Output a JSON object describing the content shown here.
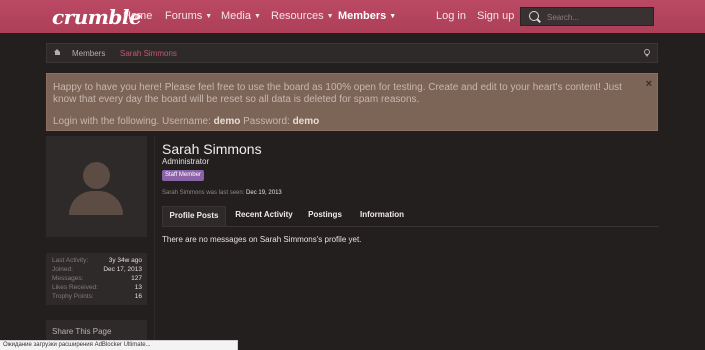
{
  "header": {
    "logo": "crumble",
    "nav": [
      {
        "label": "Home"
      },
      {
        "label": "Forums"
      },
      {
        "label": "Media"
      },
      {
        "label": "Resources"
      },
      {
        "label": "Members"
      }
    ],
    "login": "Log in",
    "signup": "Sign up",
    "search_placeholder": "Search..."
  },
  "breadcrumb": {
    "items": [
      "Members",
      "Sarah Simmons"
    ]
  },
  "notice": {
    "line1": "Happy to have you here! Please feel free to use the board as 100% open for testing. Create and edit to your heart's content! Just know that every day the board will be reset so all data is deleted for spam reasons.",
    "login_prefix": "Login with the following. Username:",
    "username": "demo",
    "password_label": "Password:",
    "password": "demo",
    "close": "×"
  },
  "profile": {
    "name": "Sarah Simmons",
    "title": "Administrator",
    "badge": "Staff Member",
    "last_seen_label": "Sarah Simmons was last seen:",
    "last_seen": "Dec 19, 2013",
    "tabs": [
      {
        "label": "Profile Posts"
      },
      {
        "label": "Recent Activity"
      },
      {
        "label": "Postings"
      },
      {
        "label": "Information"
      }
    ],
    "no_messages": "There are no messages on Sarah Simmons's profile yet."
  },
  "stats": [
    {
      "label": "Last Activity:",
      "value": "3y 34w ago"
    },
    {
      "label": "Joined:",
      "value": "Dec 17, 2013"
    },
    {
      "label": "Messages:",
      "value": "127"
    },
    {
      "label": "Likes Received:",
      "value": "13"
    },
    {
      "label": "Trophy Points:",
      "value": "16"
    }
  ],
  "share": {
    "title": "Share This Page"
  },
  "statusbar": {
    "text": "Ожидание загрузки расширения AdBlocker Ultimate..."
  }
}
